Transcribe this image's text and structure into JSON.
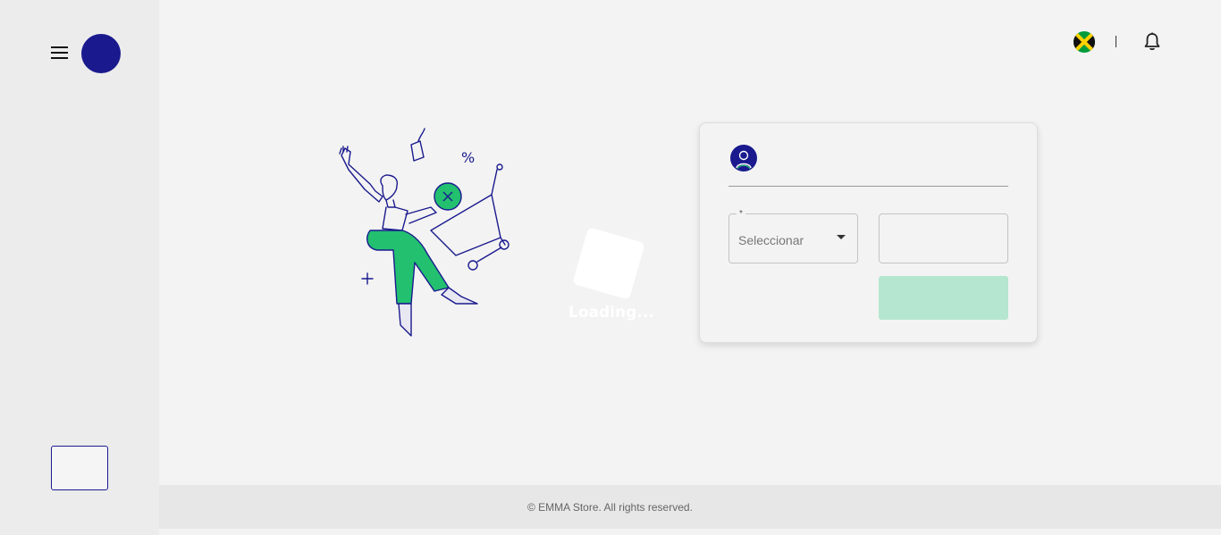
{
  "sidebar": {
    "menu_icon": "hamburger-menu-icon",
    "logo": "brand-logo",
    "logo_color": "#1a1a8e"
  },
  "topbar": {
    "flag_icon": "jamaica-flag-icon",
    "separator": "|",
    "notification_icon": "bell-icon"
  },
  "loading": {
    "text": "Loading..."
  },
  "login_card": {
    "avatar_icon": "user-avatar-icon",
    "select": {
      "required_marker": "*",
      "value": "Seleccionar"
    },
    "input": {
      "value": ""
    },
    "button": {
      "label": ""
    }
  },
  "footer": {
    "text": "© EMMA Store. All rights reserved."
  },
  "colors": {
    "accent": "#1a1a8e",
    "green": "#22c06f",
    "button_disabled": "#b5e6cf"
  }
}
